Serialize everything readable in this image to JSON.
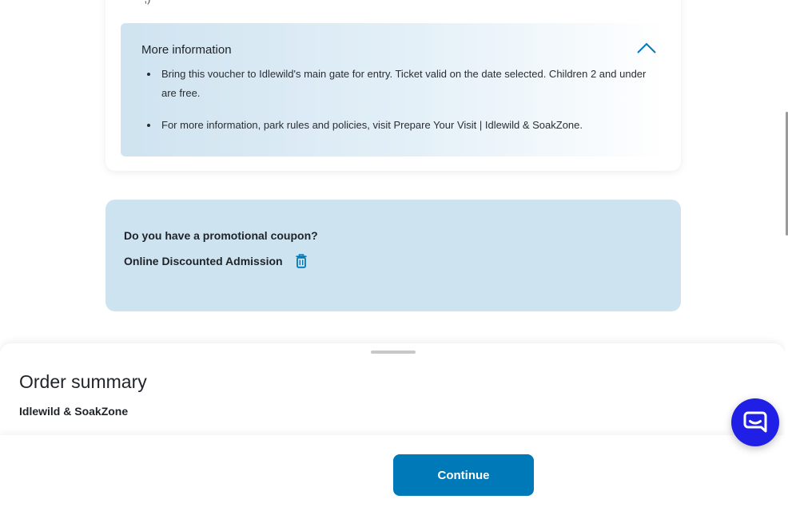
{
  "top_card": {
    "cut_text": "',)"
  },
  "more_info": {
    "title": "More information",
    "bullets": [
      "Bring this voucher to Idlewild's main gate for entry. Ticket valid on the date selected. Children 2 and under are free.",
      "For more information, park rules and policies, visit Prepare Your Visit | Idlewild & SoakZone."
    ],
    "toggle_icon": "chevron-up-icon"
  },
  "promo": {
    "question": "Do you have a promotional coupon?",
    "code": "Online Discounted Admission",
    "remove_icon": "trash-icon"
  },
  "order_summary": {
    "title": "Order summary",
    "park_name": "Idlewild & SoakZone"
  },
  "footer": {
    "continue_label": "Continue"
  },
  "chat": {
    "icon": "chat-icon"
  },
  "colors": {
    "accent": "#0079b8",
    "promo_bg": "#cde3f0",
    "chat": "#1f1fe6"
  }
}
